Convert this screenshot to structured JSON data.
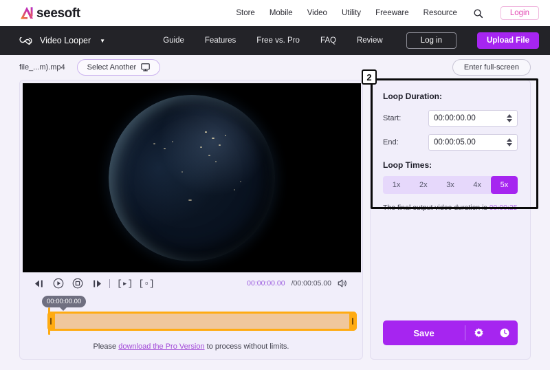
{
  "brand": {
    "name_prefix": "AI",
    "name": "seesoft",
    "accent_start": "#f5861f",
    "accent_end": "#a625f0",
    "dot_color": "#e0349c"
  },
  "topnav": {
    "items": [
      {
        "label": "Store"
      },
      {
        "label": "Mobile"
      },
      {
        "label": "Video"
      },
      {
        "label": "Utility"
      },
      {
        "label": "Freeware"
      },
      {
        "label": "Resource"
      }
    ],
    "search_icon": "search-icon",
    "login_label": "Login"
  },
  "darknav": {
    "product_icon": "infinity-icon",
    "product_label": "Video Looper",
    "caret": "▼",
    "links": [
      {
        "label": "Guide"
      },
      {
        "label": "Features"
      },
      {
        "label": "Free vs. Pro"
      },
      {
        "label": "FAQ"
      },
      {
        "label": "Review"
      }
    ],
    "login_label": "Log in",
    "upload_label": "Upload File"
  },
  "filerow": {
    "filename": "file_...m).mp4",
    "select_another_label": "Select Another",
    "monitor_icon": "monitor-icon",
    "fullscreen_label": "Enter full-screen"
  },
  "player": {
    "controls": [
      {
        "name": "rewind-icon"
      },
      {
        "name": "play-icon"
      },
      {
        "name": "stop-icon"
      },
      {
        "name": "fast-forward-icon"
      }
    ],
    "set_start_label": "[▸]",
    "set_end_label": "[▫]",
    "current_time": "00:00:00.00",
    "separator": "/",
    "total_time": "00:00:05.00",
    "volume_icon": "volume-icon"
  },
  "timeline": {
    "tooltip_time": "00:00:00.00",
    "trim_color": "#ffab12"
  },
  "pro_note": {
    "prefix": "Please ",
    "link": "download the Pro Version",
    "suffix": " to process without limits."
  },
  "panel": {
    "step_number": "2",
    "loop_duration_title": "Loop Duration:",
    "start_label": "Start:",
    "start_value": "00:00:00.00",
    "end_label": "End:",
    "end_value": "00:00:05.00",
    "loop_times_title": "Loop Times:",
    "loop_options": [
      {
        "label": "1x",
        "active": false
      },
      {
        "label": "2x",
        "active": false
      },
      {
        "label": "3x",
        "active": false
      },
      {
        "label": "4x",
        "active": false
      },
      {
        "label": "5x",
        "active": true
      }
    ],
    "final_note_prefix": "The final output video duration is ",
    "final_note_value": "00:00:25",
    "save_label": "Save",
    "settings_icon": "gear-icon",
    "history_icon": "clock-icon",
    "accent_color": "#a625f0"
  }
}
